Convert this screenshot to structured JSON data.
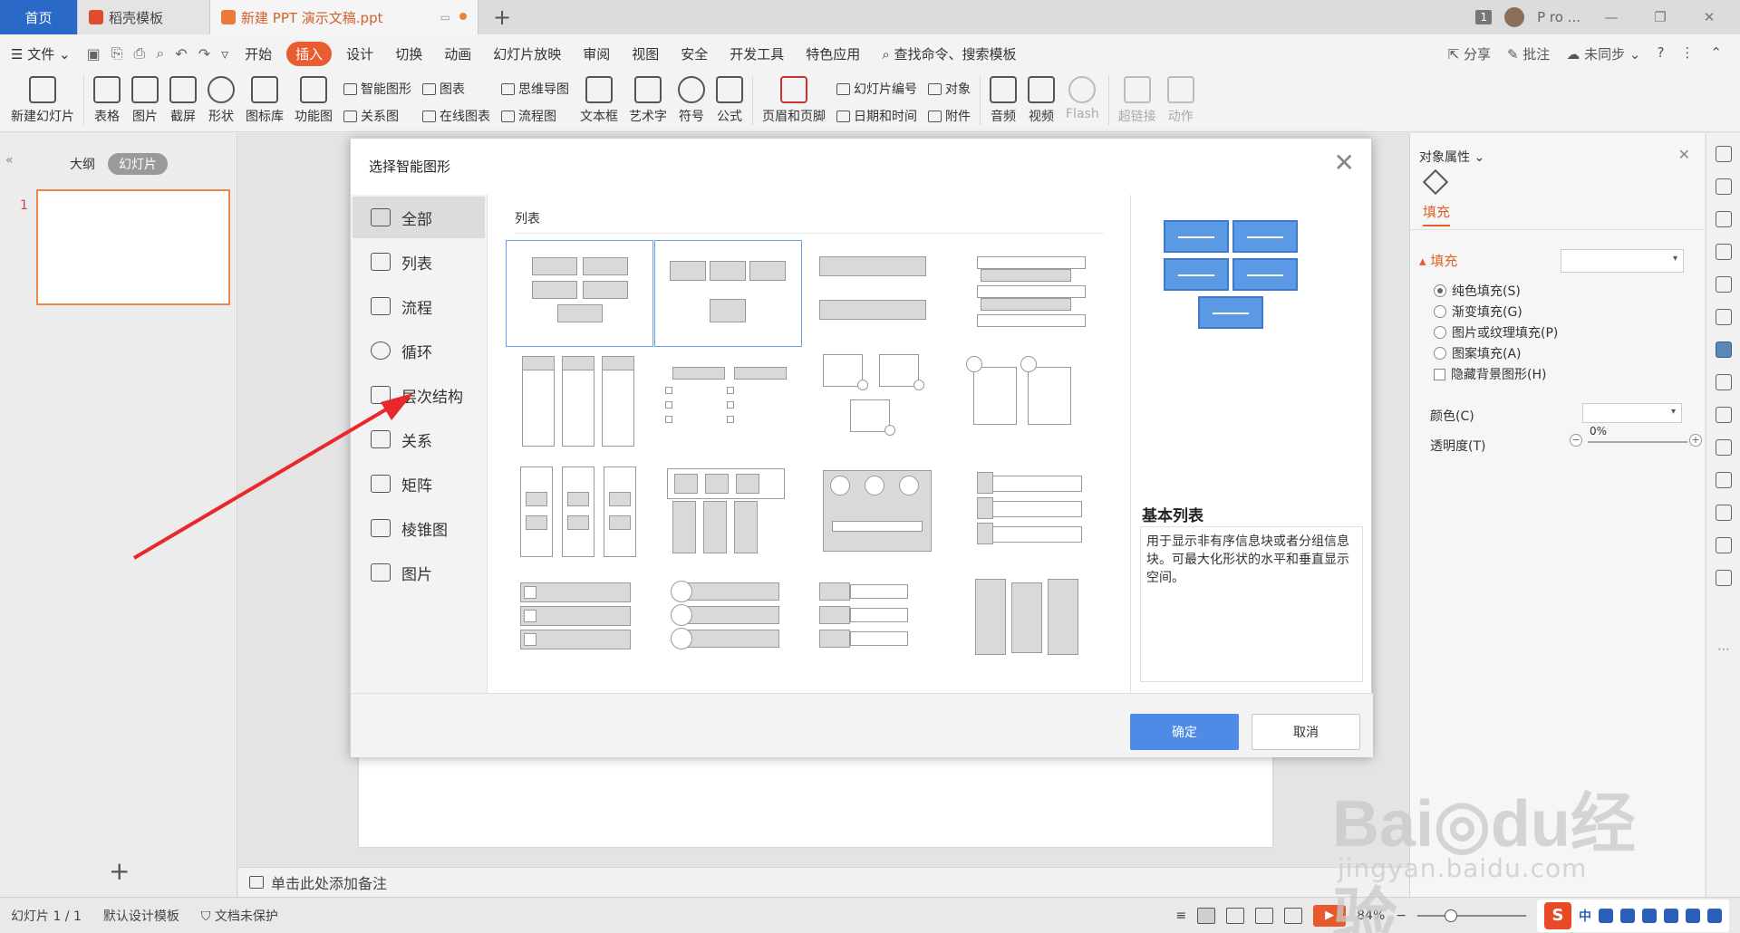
{
  "tabs": {
    "home": "首页",
    "template": "稻壳模板",
    "document": "新建 PPT 演示文稿.ppt",
    "badge": "1",
    "user": "P ro ..."
  },
  "menu": {
    "file": "文件",
    "items": [
      "开始",
      "插入",
      "设计",
      "切换",
      "动画",
      "幻灯片放映",
      "审阅",
      "视图",
      "安全",
      "开发工具",
      "特色应用"
    ],
    "active": "插入",
    "search": "查找命令、搜索模板",
    "share": "分享",
    "comment": "批注",
    "sync": "未同步"
  },
  "ribbon": {
    "new_slide": "新建幻灯片",
    "table": "表格",
    "picture": "图片",
    "screenshot": "截屏",
    "shape": "形状",
    "icon_lib": "图标库",
    "func_chart": "功能图",
    "smart_art": "智能图形",
    "chart": "图表",
    "relation": "关系图",
    "online_chart": "在线图表",
    "mindmap": "思维导图",
    "flowchart": "流程图",
    "textbox": "文本框",
    "arttext": "艺术字",
    "symbol": "符号",
    "formula": "公式",
    "header_footer": "页眉和页脚",
    "slide_number": "幻灯片编号",
    "object": "对象",
    "datetime": "日期和时间",
    "attachment": "附件",
    "audio": "音频",
    "video": "视频",
    "flash": "Flash",
    "hyperlink": "超链接",
    "action": "动作"
  },
  "left_panel": {
    "outline": "大纲",
    "slides": "幻灯片",
    "slide_number": "1"
  },
  "notes": {
    "placeholder": "单击此处添加备注"
  },
  "right_panel": {
    "title": "对象属性",
    "fill_tab": "填充",
    "section": "填充",
    "options": [
      "纯色填充(S)",
      "渐变填充(G)",
      "图片或纹理填充(P)",
      "图案填充(A)"
    ],
    "checkbox": "隐藏背景图形(H)",
    "color_label": "颜色(C)",
    "transparency_label": "透明度(T)",
    "transparency_value": "0%"
  },
  "dialog": {
    "title": "选择智能图形",
    "categories": [
      "全部",
      "列表",
      "流程",
      "循环",
      "层次结构",
      "关系",
      "矩阵",
      "棱锥图",
      "图片"
    ],
    "selected_category": "全部",
    "section_label": "列表",
    "preview_name": "基本列表",
    "preview_desc": "用于显示非有序信息块或者分组信息块。可最大化形状的水平和垂直显示空间。",
    "ok": "确定",
    "cancel": "取消"
  },
  "status": {
    "slide_info": "幻灯片 1 / 1",
    "template": "默认设计模板",
    "protection": "文档未保护",
    "zoom": "84%"
  },
  "ime": {
    "mode": "中"
  },
  "colors": {
    "accent": "#e95c2f",
    "home_tab": "#2b69c9",
    "ok_button": "#4f8ae6",
    "preview_box": "#5c9ae6",
    "arrow": "#e8282a"
  }
}
